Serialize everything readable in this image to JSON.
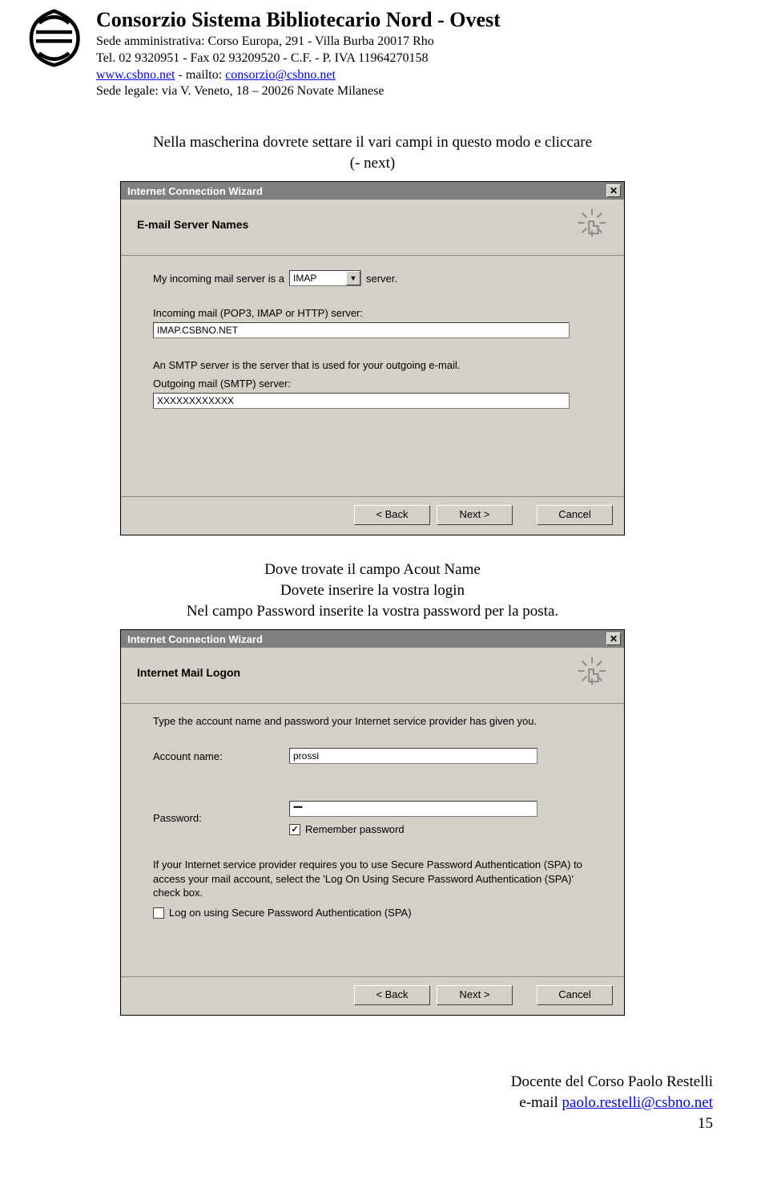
{
  "header": {
    "org": "Consorzio Sistema Bibliotecario Nord - Ovest",
    "address": "Sede amministrativa: Corso Europa, 291 - Villa Burba 20017 Rho",
    "tel": "Tel. 02 9320951 - Fax 02 93209520  - C.F. - P. IVA 11964270158",
    "link1": "www.csbno.net",
    "link_sep": " - mailto: ",
    "link2": "consorzio@csbno.net",
    "sede_legale": "Sede legale: via V. Veneto, 18 – 20026 Novate Milanese"
  },
  "intro1": "Nella mascherina dovrete settare il vari campi in questo modo e cliccare\n(- next)",
  "dialog1": {
    "title": "Internet Connection Wizard",
    "heading": "E-mail Server Names",
    "row1_pre": "My incoming mail server is a",
    "row1_select": "IMAP",
    "row1_post": "server.",
    "row2_label": "Incoming mail (POP3, IMAP or HTTP) server:",
    "row2_value": "IMAP.CSBNO.NET",
    "smtp_note": "An SMTP server is the server that is used for your outgoing e-mail.",
    "row3_label": "Outgoing mail (SMTP) server:",
    "row3_value": "XXXXXXXXXXXX",
    "btn_back": "< Back",
    "btn_next": "Next >",
    "btn_cancel": "Cancel"
  },
  "intro2": "Dove trovate il campo Acout Name\nDovete inserire la vostra login\nNel campo Password inserite la vostra password per la posta.",
  "dialog2": {
    "title": "Internet Connection Wizard",
    "heading": "Internet Mail Logon",
    "instr": "Type the account name and password your Internet service provider has given you.",
    "account_label": "Account name:",
    "account_value": "prossi",
    "password_label": "Password:",
    "password_value": "•••••",
    "remember": "Remember password",
    "spa_text": "If your Internet service provider requires you to use Secure Password Authentication (SPA) to access your mail account, select the 'Log On Using Secure Password Authentication (SPA)' check box.",
    "spa_check": "Log on using Secure Password Authentication (SPA)",
    "btn_back": "< Back",
    "btn_next": "Next >",
    "btn_cancel": "Cancel"
  },
  "footer": {
    "line1": "Docente del Corso Paolo Restelli",
    "mail_prefix": "e-mail ",
    "mail": "paolo.restelli@csbno.net",
    "page": "15"
  }
}
